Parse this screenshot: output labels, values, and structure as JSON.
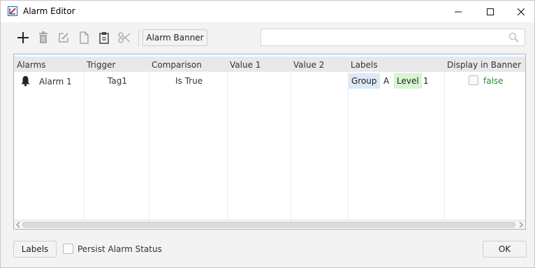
{
  "window": {
    "title": "Alarm Editor"
  },
  "toolbar": {
    "icons": [
      "add-icon",
      "delete-icon",
      "edit-icon",
      "copy-icon",
      "paste-icon",
      "cut-icon"
    ],
    "alarm_banner_label": "Alarm Banner",
    "search": {
      "value": "",
      "placeholder": ""
    }
  },
  "table": {
    "headers": [
      "Alarms",
      "Trigger",
      "Comparison",
      "Value 1",
      "Value 2",
      "Labels",
      "Display in Banner"
    ],
    "rows": [
      {
        "alarm": "Alarm 1",
        "trigger": "Tag1",
        "comparison": "Is True",
        "value1": "",
        "value2": "",
        "labels": [
          {
            "key": "Group",
            "value": "A"
          },
          {
            "key": "Level",
            "value": "1"
          }
        ],
        "display_in_banner": "false"
      }
    ]
  },
  "footer": {
    "labels_button": "Labels",
    "persist_label": "Persist Alarm Status",
    "ok_button": "OK"
  },
  "colors": {
    "group_chip": "#dbe9f8",
    "level_chip": "#d6f5d0",
    "false_text": "#2e8b2e",
    "grid_border": "#9ab8d6"
  }
}
